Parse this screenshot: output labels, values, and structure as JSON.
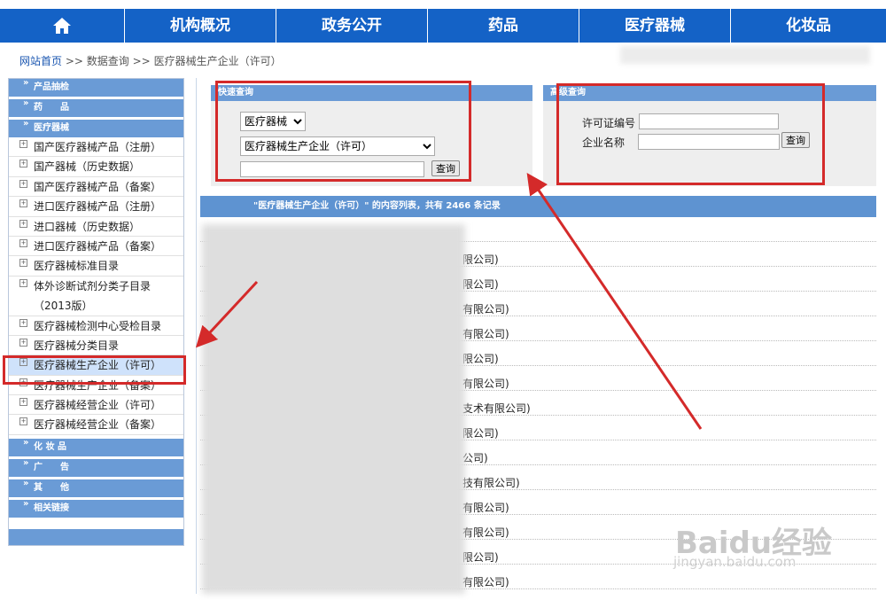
{
  "nav": {
    "home_icon": "home-icon",
    "items": [
      "机构概况",
      "政务公开",
      "药品",
      "医疗器械",
      "化妆品"
    ]
  },
  "breadcrumb": {
    "home": "网站首页",
    "sep1": ">>",
    "mid": "数据查询",
    "sep2": ">>",
    "current": "医疗器械生产企业（许可）"
  },
  "sidebar": {
    "sec_top": [
      "产品抽检",
      "药　　品",
      "医疗器械"
    ],
    "items": [
      "国产医疗器械产品（注册）",
      "国产器械（历史数据）",
      "国产医疗器械产品（备案）",
      "进口医疗器械产品（注册）",
      "进口器械（历史数据）",
      "进口医疗器械产品（备案）",
      "医疗器械标准目录",
      "体外诊断试剂分类子目录（2013版）",
      "医疗器械检测中心受检目录",
      "医疗器械分类目录",
      "医疗器械生产企业（许可）",
      "医疗器械生产企业（备案）",
      "医疗器械经营企业（许可）",
      "医疗器械经营企业（备案）"
    ],
    "sec_bottom": [
      "化 妆 品",
      "广　　告",
      "其　　他",
      "相关链接"
    ]
  },
  "quick_search": {
    "title": "快速查询",
    "category": "医疗器械",
    "dataset": "医疗器械生产企业（许可）",
    "keyword": "",
    "button": "查询"
  },
  "advanced_search": {
    "title": "高级查询",
    "license_label": "许可证编号",
    "company_label": "企业名称",
    "license_value": "",
    "company_value": "",
    "button": "查询"
  },
  "list": {
    "header": "\"医疗器械生产企业（许可）\" 的内容列表，共有 2466 条记录",
    "rows": [
      "",
      "限公司)",
      "限公司)",
      "有限公司)",
      "有限公司)",
      "限公司)",
      "有限公司)",
      "支术有限公司)",
      "限公司)",
      "公司)",
      "技有限公司)",
      "有限公司)",
      "有限公司)",
      "限公司)",
      "有限公司)"
    ]
  },
  "watermark": {
    "brand": "Baidu经验",
    "url": "jingyan.baidu.com"
  },
  "colors": {
    "nav": "#1462c6",
    "section": "#6a9bd6",
    "annotation": "#d42a2a"
  }
}
